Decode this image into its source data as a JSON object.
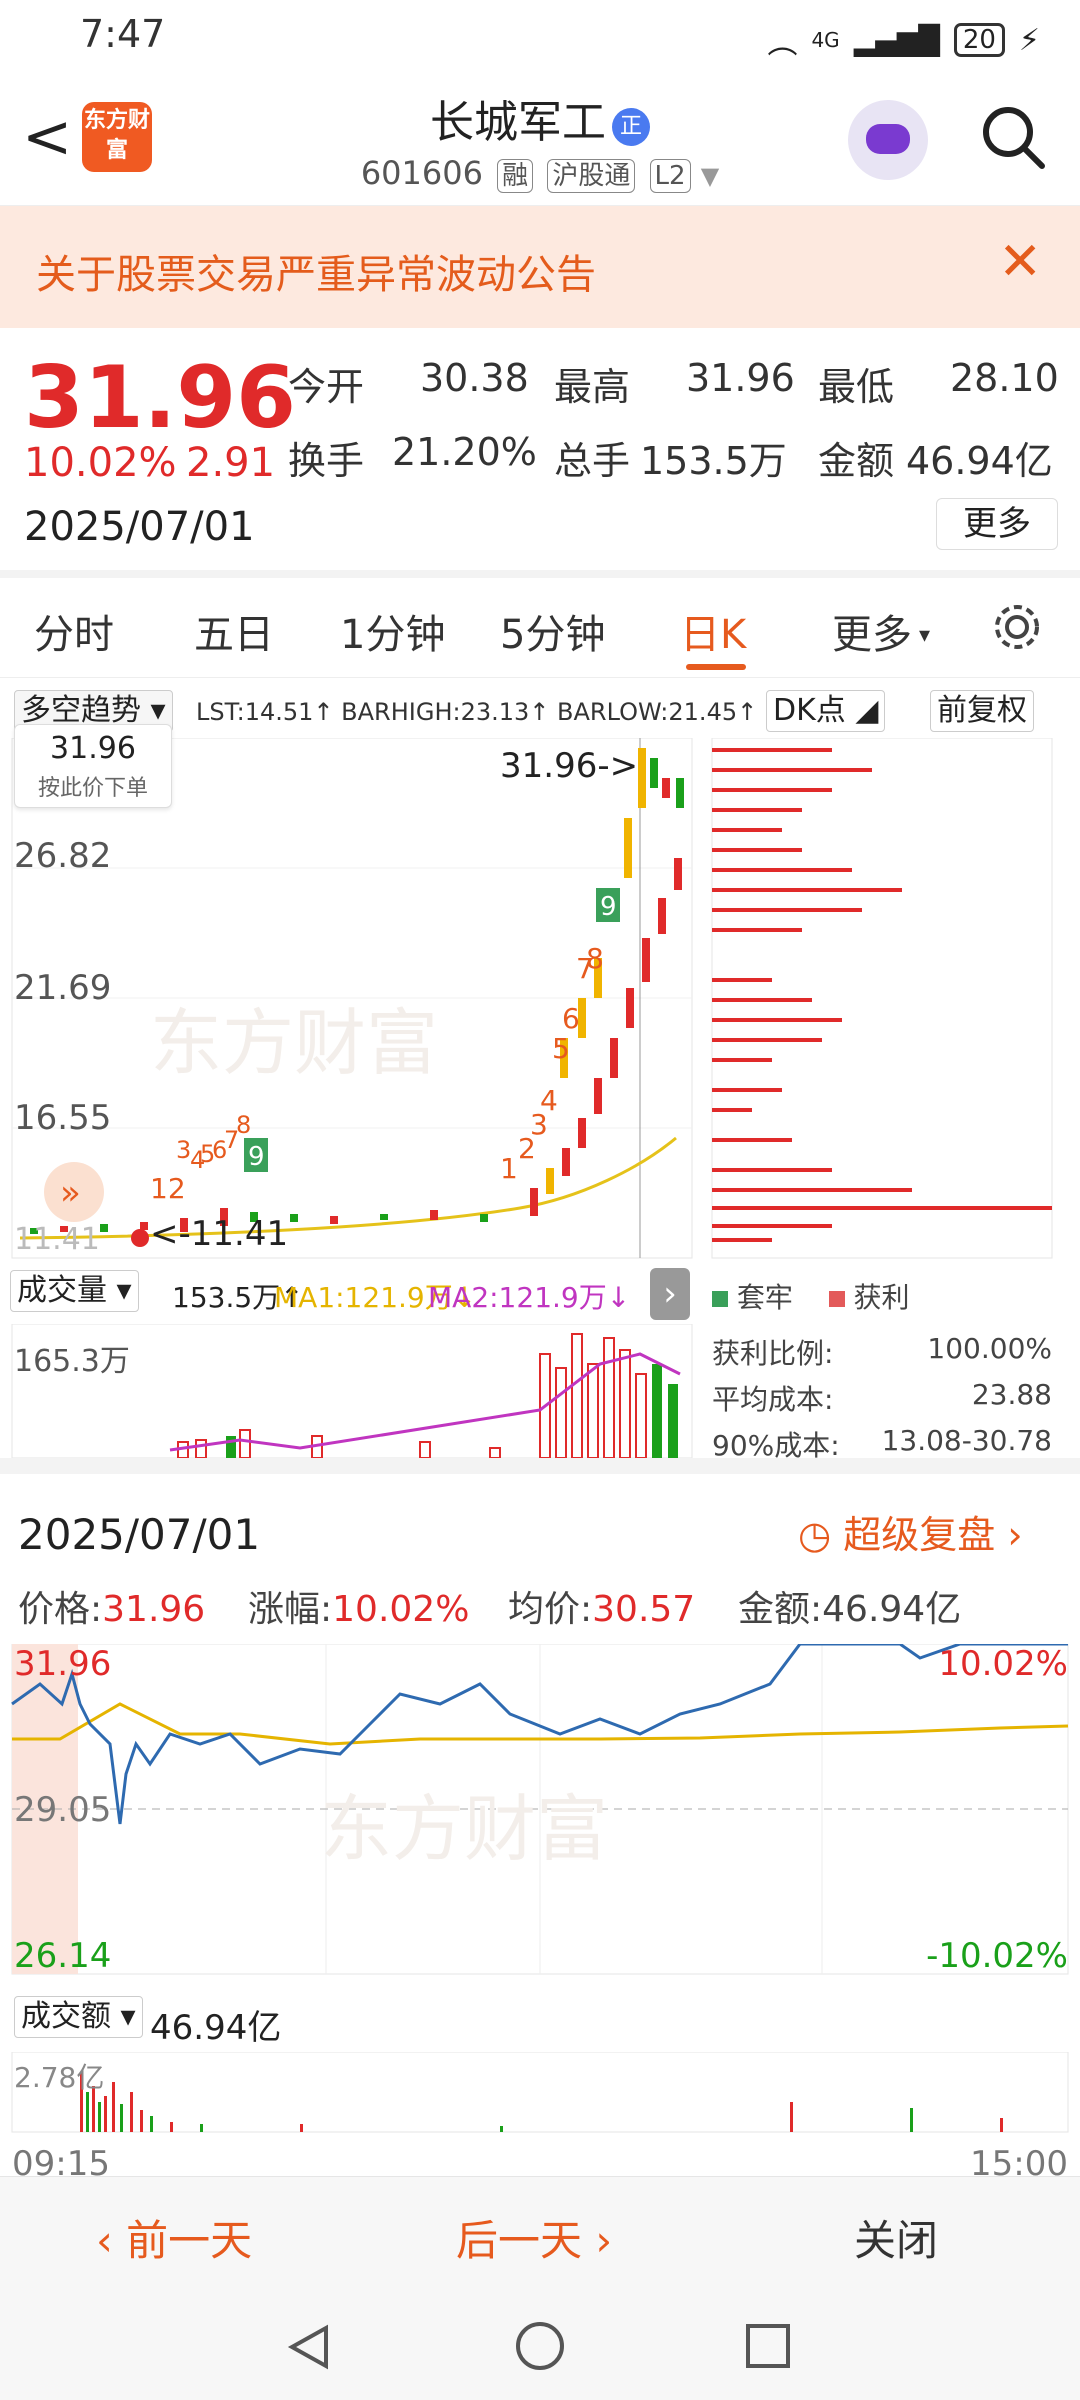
{
  "status": {
    "time": "7:47",
    "battery": "20",
    "network": "4G"
  },
  "header": {
    "title": "长城军工",
    "title_badge": "正",
    "code": "601606",
    "tags": [
      "融",
      "沪股通",
      "L2"
    ],
    "logo_text": "东方财富"
  },
  "notice": {
    "text": "关于股票交易严重异常波动公告"
  },
  "quote": {
    "price": "31.96",
    "change_pct": "10.02%",
    "change": "2.91",
    "date": "2025/07/01",
    "open_label": "今开",
    "open": "30.38",
    "high_label": "最高",
    "high": "31.96",
    "low_label": "最低",
    "low": "28.10",
    "turnover_label": "换手",
    "turnover": "21.20%",
    "volume_label": "总手",
    "volume": "153.5万",
    "amount_label": "金额",
    "amount": "46.94亿",
    "more": "更多"
  },
  "tabs": [
    "分时",
    "五日",
    "1分钟",
    "5分钟",
    "日K",
    "更多"
  ],
  "kchart": {
    "indicator_select": "多空趋势",
    "indicator_text": "LST:14.51↑ BARHIGH:23.13↑ BARLOW:21.45↑",
    "dk_btn": "DK点",
    "adj_btn": "前复权",
    "tip_price": "31.96",
    "tip_label": "按此价下单",
    "y_labels": [
      "26.82",
      "21.69",
      "16.55"
    ],
    "high_marker": "31.96->",
    "low_marker": "<-11.41",
    "low_left": "11.41",
    "vol_select": "成交量",
    "vol_text": "153.5万↑",
    "ma1": "MA1:121.9万↓",
    "ma2": "MA2:121.9万↓",
    "vol_max": "165.3万",
    "legend_trap": "套牢",
    "legend_profit": "获利",
    "profit_ratio_label": "获利比例:",
    "profit_ratio": "100.00%",
    "avg_cost_label": "平均成本:",
    "avg_cost": "23.88",
    "cost90_label": "90%成本:",
    "cost90": "13.08-30.78"
  },
  "intraday": {
    "date": "2025/07/01",
    "replay": "超级复盘",
    "price_label": "价格:",
    "price": "31.96",
    "pct_label": "涨幅:",
    "pct": "10.02%",
    "avg_label": "均价:",
    "avg": "30.57",
    "amount_label": "金额:",
    "amount": "46.94亿",
    "top": "31.96",
    "mid": "29.05",
    "bottom": "26.14",
    "top_pct": "10.02%",
    "bottom_pct": "-10.02%",
    "amt_select": "成交额",
    "amt_value": "46.94亿",
    "amt_max": "2.78亿",
    "t_start": "09:15",
    "t_end": "15:00"
  },
  "footer": {
    "prev": "前一天",
    "next": "后一天",
    "close": "关闭"
  },
  "colors": {
    "up": "#e02a2a",
    "down": "#1aa01a",
    "accent": "#e65a1e"
  }
}
